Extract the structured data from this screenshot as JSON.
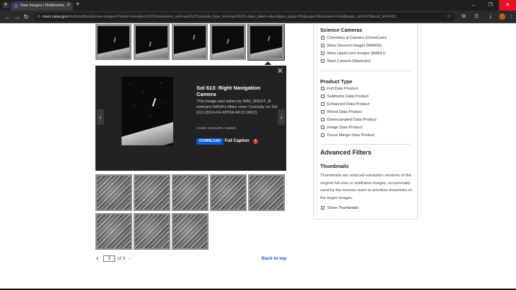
{
  "browser": {
    "tab_title": "Raw Images | Multimedia – NA",
    "tab_close": "✕",
    "new_tab": "+",
    "url_host": "mars.nasa.gov",
    "url_path": "/msl/multimedia/raw-images/?order=sol+desc%2Cinstrument_sort+asc%2Csample_type_sort+asc%2C+date_taken+desc&per_page=50&page=2&mission=msl&begin_sol=613&end_sol=613",
    "window_controls": {
      "minimize": "–",
      "maximize": "❐",
      "close": "✕"
    },
    "icons": {
      "back": "back-arrow-icon",
      "forward": "forward-arrow-icon",
      "reload": "reload-icon",
      "star": "star-icon",
      "extensions": "extensions-icon",
      "downloads": "download-icon"
    }
  },
  "viewer": {
    "title": "Sol 613: Right Navigation Camera",
    "description": "This image was taken by NAV_RIGHT_B onboard NASA's Mars rover Curiosity on Sol 613 (2014-04-28T04:48:22.000Z)",
    "credit": "Credit: NASA/JPL-Caltech",
    "download_label": "DOWNLOAD",
    "caption_label": "Full Caption",
    "close_symbol": "✕",
    "prev_symbol": "‹",
    "next_symbol": "›"
  },
  "pager": {
    "current": "3",
    "of_label": "of 3",
    "prev_symbol": "‹",
    "next_symbol": "›",
    "back_to_top": "Back to top"
  },
  "filters": {
    "science_cameras_heading": "Science Cameras",
    "science_cameras": [
      "Chemistry & Camera (ChemCam)",
      "Mars Descent Imager (MARDI)",
      "Mars Hand Lens Imager (MAHLI)",
      "Mast Camera (Mastcam)"
    ],
    "product_type_heading": "Product Type",
    "product_types": [
      "Full Data Product",
      "Subframe Data Product",
      "Enhanced Data Product",
      "Mixed Data Product",
      "Downsampled Data Product",
      "Image Data Product",
      "Focus Merge Data Product"
    ],
    "advanced_heading": "Advanced Filters",
    "thumbnails_heading": "Thumbnails",
    "thumbnails_desc": "Thumbnails are reduced-resolution versions of the original full-size or subframe images, occasionally used by the mission team to prioritize downlinks of the larger images.",
    "show_thumbnails": "Show Thumbnails"
  }
}
